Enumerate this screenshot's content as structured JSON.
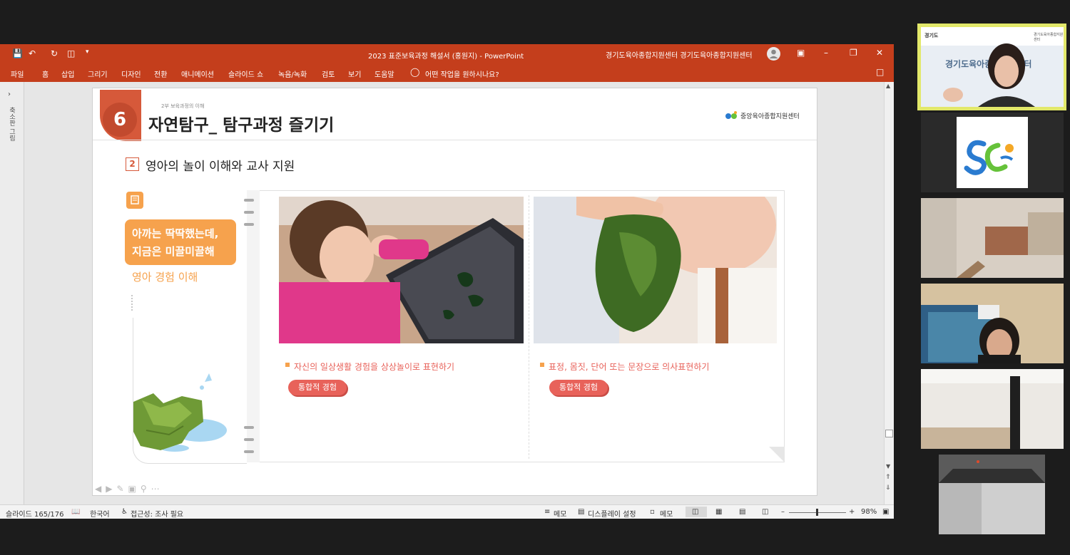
{
  "window": {
    "title": "2023 표준보육과정 해설서 (홍원지)  -  PowerPoint",
    "account": "경기도육아종합지원센터 경기도육아종합지원센터"
  },
  "ribbon": {
    "tabs": [
      "파일",
      "홈",
      "삽입",
      "그리기",
      "디자인",
      "전환",
      "애니메이션",
      "슬라이드 쇼",
      "녹음/녹화",
      "검토",
      "보기",
      "도움말"
    ],
    "tell_me": "어떤 작업을 원하시나요?"
  },
  "thumbpane": {
    "label": "축소판 그림"
  },
  "slide": {
    "number": "6",
    "breadcrumb": "2부 보육과정의 이해",
    "title": "자연탐구_ 탐구과정 즐기기",
    "logo_text": "중앙육아종합지원센터",
    "section_num": "2",
    "section_title": "영아의 놀이 이해와 교사 지원",
    "callout_line1": "아까는 딱딱했는데,",
    "callout_line2": "지금은 미끌미끌해",
    "callout_sub": "영아 경험 이해",
    "cards": [
      {
        "caption": "자신의 일상생활 경험을 상상놀이로 표현하기",
        "tag": "통합적 경험"
      },
      {
        "caption": "표정, 몸짓, 단어 또는 문장으로 의사표현하기",
        "tag": "통합적 경험"
      }
    ]
  },
  "statusbar": {
    "slide_pos": "슬라이드 165/176",
    "language": "한국어",
    "accessibility": "접근성: 조사 필요",
    "notes": "메모",
    "display_settings": "디스플레이 설정",
    "comments": "메모",
    "zoom": "98%"
  },
  "participants": {
    "speaker_org_left": "경기도",
    "speaker_org_right": "경기도육아종합지원센터",
    "speaker_banner": "경기도육아종합지원센터"
  },
  "colors": {
    "ppt_red": "#c43e1c",
    "accent_orange": "#f6a24d",
    "tag_red": "#e8625a",
    "speaker_border": "#e2e86a"
  }
}
